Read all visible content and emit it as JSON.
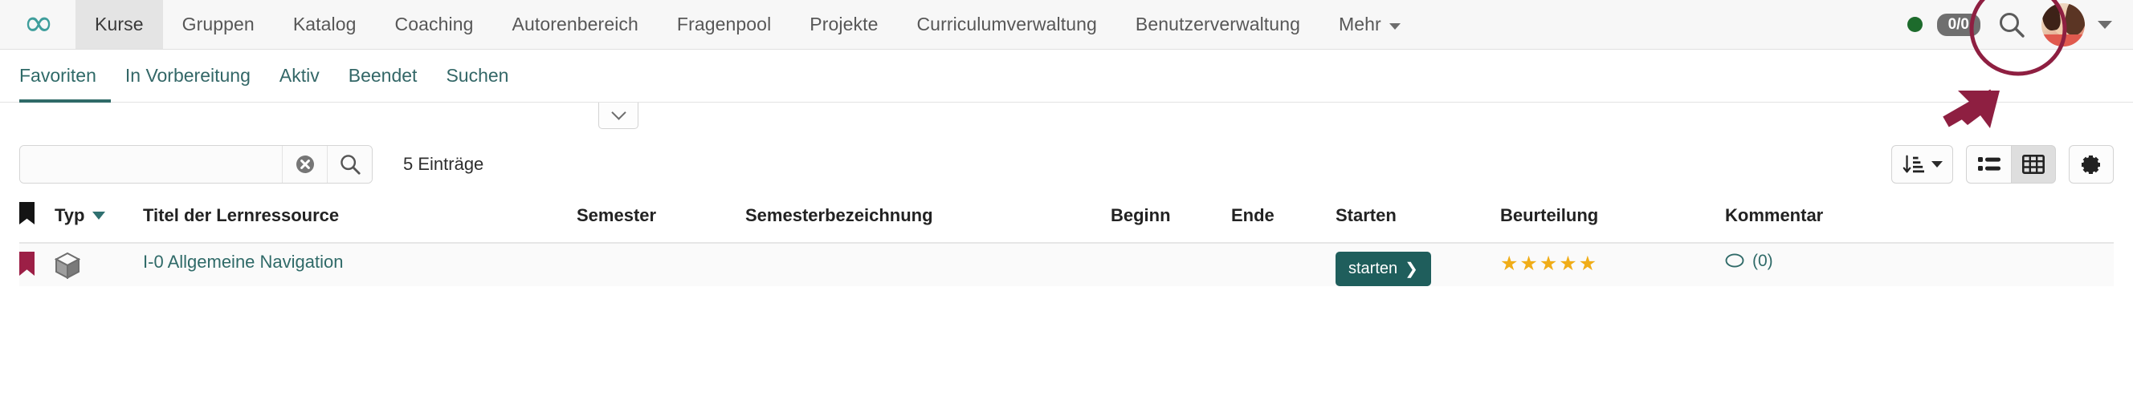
{
  "header": {
    "logo_icon": "infinity-logo",
    "nav_items": [
      {
        "label": "Kurse",
        "active": true
      },
      {
        "label": "Gruppen",
        "active": false
      },
      {
        "label": "Katalog",
        "active": false
      },
      {
        "label": "Coaching",
        "active": false
      },
      {
        "label": "Autorenbereich",
        "active": false
      },
      {
        "label": "Fragenpool",
        "active": false
      },
      {
        "label": "Projekte",
        "active": false
      },
      {
        "label": "Curriculumverwaltung",
        "active": false
      },
      {
        "label": "Benutzerverwaltung",
        "active": false
      },
      {
        "label": "Mehr",
        "active": false,
        "has_caret": true
      }
    ],
    "status_dot_color": "#1d6b2c",
    "counter_badge": "0/0",
    "search_icon": "search-icon",
    "avatar_icon": "user-avatar",
    "avatar_caret_icon": "chevron-down-icon"
  },
  "annotation": {
    "ellipse_color": "#8e1f41",
    "arrow_color": "#8e1f41",
    "target": "user-avatar"
  },
  "subtabs": [
    {
      "label": "Favoriten",
      "active": true
    },
    {
      "label": "In Vorbereitung",
      "active": false
    },
    {
      "label": "Aktiv",
      "active": false
    },
    {
      "label": "Beendet",
      "active": false
    },
    {
      "label": "Suchen",
      "active": false
    }
  ],
  "collapse_button": {
    "icon": "chevron-down-icon"
  },
  "toolbar": {
    "search_value": "",
    "search_placeholder": "",
    "clear_icon": "clear-circle-icon",
    "search_icon": "search-icon",
    "entries_label": "5 Einträge",
    "sort_button": {
      "icon": "sort-descending-icon",
      "caret": "chevron-down-icon"
    },
    "view_list_button": {
      "icon": "list-view-icon",
      "selected": false
    },
    "view_table_button": {
      "icon": "table-view-icon",
      "selected": true
    },
    "settings_button": {
      "icon": "gear-icon"
    }
  },
  "table": {
    "columns": [
      {
        "key": "flag",
        "label": "",
        "icon": "bookmark-icon"
      },
      {
        "key": "typ",
        "label": "Typ",
        "sort_icon": "sort-caret-icon"
      },
      {
        "key": "titel",
        "label": "Titel der Lernressource"
      },
      {
        "key": "semester",
        "label": "Semester"
      },
      {
        "key": "semesterbezeichnung",
        "label": "Semesterbezeichnung"
      },
      {
        "key": "beginn",
        "label": "Beginn"
      },
      {
        "key": "ende",
        "label": "Ende"
      },
      {
        "key": "starten",
        "label": "Starten"
      },
      {
        "key": "beurteilung",
        "label": "Beurteilung"
      },
      {
        "key": "kommentar",
        "label": "Kommentar"
      }
    ],
    "rows": [
      {
        "flag_color": "#9c1f46",
        "typ_icon": "course-cube-icon",
        "titel": "I-0 Allgemeine Navigation",
        "semester": "",
        "semesterbezeichnung": "",
        "beginn": "",
        "ende": "",
        "starten_label": "starten",
        "beurteilung_stars": "★★★★★",
        "kommentar_count": "(0)"
      }
    ]
  }
}
